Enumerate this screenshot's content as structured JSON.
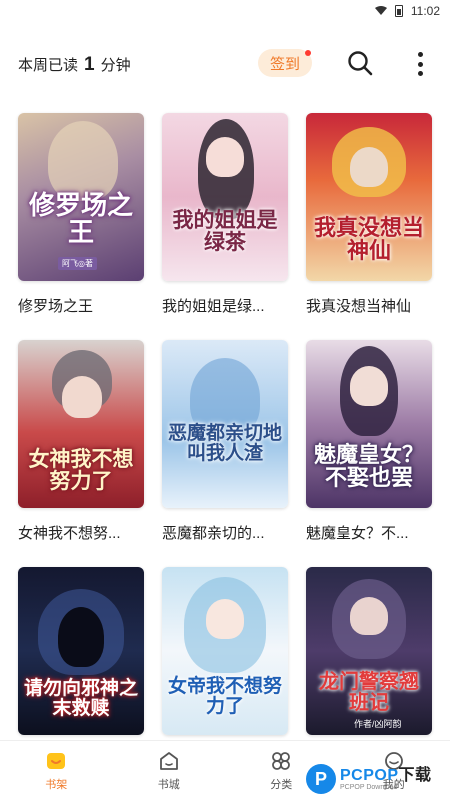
{
  "status_bar": {
    "time": "11:02",
    "icons": [
      "wifi-icon",
      "battery-icon"
    ]
  },
  "header": {
    "read_prefix": "本周已读",
    "read_value": "1",
    "read_unit": "分钟",
    "checkin_label": "签到",
    "search_icon": "search-icon",
    "more_icon": "more-vertical-icon"
  },
  "books": [
    {
      "title": "修罗场之王",
      "cover_text": "修罗场之王",
      "cover_author": "阿飞◎著"
    },
    {
      "title": "我的姐姐是绿...",
      "cover_text": "我的姐姐是绿茶"
    },
    {
      "title": "我真没想当神仙",
      "cover_text": "我真没想当神仙"
    },
    {
      "title": "女神我不想努...",
      "cover_text": "女神我不想努力了"
    },
    {
      "title": "恶魔都亲切的...",
      "cover_text": "恶魔都亲切地叫我人渣"
    },
    {
      "title": "魅魔皇女？不...",
      "cover_text": "魅魔皇女？不娶也罢"
    },
    {
      "title": "",
      "cover_text": "请勿向邪神之末救赎"
    },
    {
      "title": "",
      "cover_text": "女帝我不想努力了"
    },
    {
      "title": "",
      "cover_text": "龙门警察翘班记",
      "cover_author": "作者/凶阿韵"
    }
  ],
  "nav": {
    "items": [
      {
        "label": "书架",
        "icon": "bookshelf-icon",
        "active": true
      },
      {
        "label": "书城",
        "icon": "bookstore-icon",
        "active": false
      },
      {
        "label": "分类",
        "icon": "category-icon",
        "active": false
      },
      {
        "label": "我的",
        "icon": "profile-icon",
        "active": false
      }
    ]
  },
  "watermark": {
    "brand_blue": "PCPOP",
    "brand_dark": "下载",
    "sub": "PCPOP Download"
  },
  "colors": {
    "accent": "#f07a2a",
    "checkin_bg": "#fdecd9",
    "badge": "#ff3b30",
    "watermark": "#1688e8"
  }
}
